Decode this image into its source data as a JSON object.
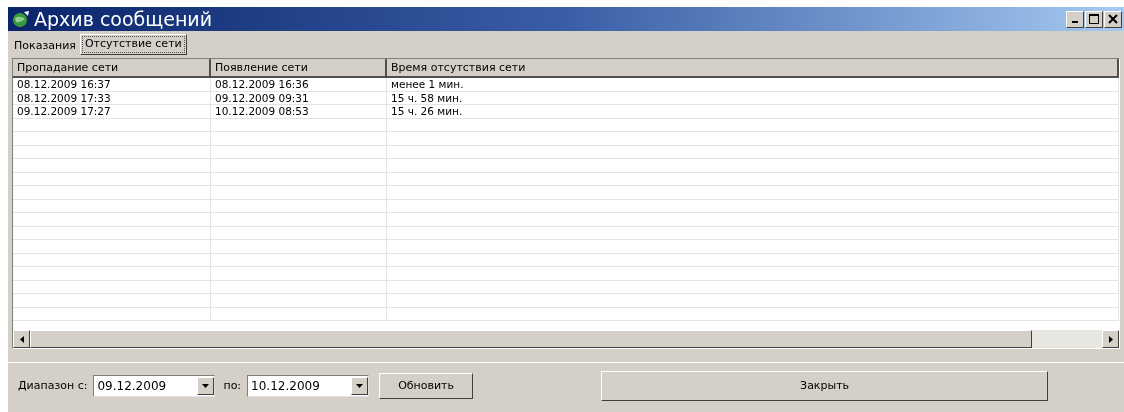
{
  "window": {
    "title": "Архив сообщений"
  },
  "tabs": [
    {
      "label": "Показания",
      "selected": false
    },
    {
      "label": "Отсутствие сети",
      "selected": true
    }
  ],
  "table": {
    "columns": [
      "Пропадание сети",
      "Появление сети",
      "Время отсутствия сети"
    ],
    "rows": [
      [
        "08.12.2009 16:37",
        "08.12.2009 16:36",
        "менее 1 мин."
      ],
      [
        "08.12.2009 17:33",
        "09.12.2009 09:31",
        "15 ч. 58 мин."
      ],
      [
        "09.12.2009 17:27",
        "10.12.2009 08:53",
        "15 ч. 26 мин."
      ]
    ]
  },
  "footer": {
    "range_from_label": "Диапазон с:",
    "range_from": "09.12.2009",
    "range_to_label": "по:",
    "range_to": "10.12.2009",
    "refresh_button": "Обновить",
    "close_button": "Закрыть"
  }
}
